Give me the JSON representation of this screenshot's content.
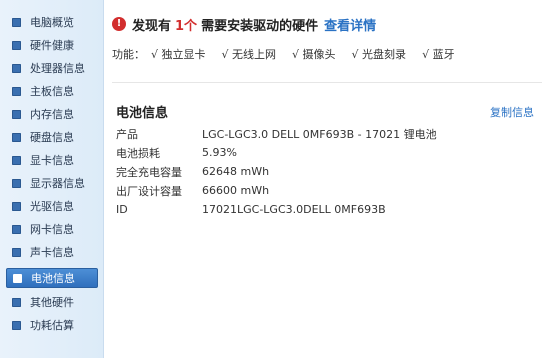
{
  "sidebar": {
    "items": [
      {
        "label": "电脑概览"
      },
      {
        "label": "硬件健康"
      },
      {
        "label": "处理器信息"
      },
      {
        "label": "主板信息"
      },
      {
        "label": "内存信息"
      },
      {
        "label": "硬盘信息"
      },
      {
        "label": "显卡信息"
      },
      {
        "label": "显示器信息"
      },
      {
        "label": "光驱信息"
      },
      {
        "label": "网卡信息"
      },
      {
        "label": "声卡信息"
      },
      {
        "label": "电池信息"
      },
      {
        "label": "其他硬件"
      },
      {
        "label": "功耗估算"
      }
    ],
    "active_index": 11
  },
  "alert": {
    "icon": "exclamation-icon",
    "prefix": "发现有",
    "count": "1个",
    "suffix": "需要安装驱动的硬件",
    "link": "查看详情"
  },
  "features": {
    "label": "功能：",
    "items": [
      "√ 独立显卡",
      "√ 无线上网",
      "√ 摄像头",
      "√ 光盘刻录",
      "√ 蓝牙"
    ]
  },
  "battery": {
    "title": "电池信息",
    "copy_label": "复制信息",
    "rows": [
      {
        "key": "产品",
        "value": "LGC-LGC3.0 DELL 0MF693B - 17021 锂电池"
      },
      {
        "key": "电池损耗",
        "value": "5.93%"
      },
      {
        "key": "完全充电容量",
        "value": "62648 mWh"
      },
      {
        "key": "出厂设计容量",
        "value": "66600 mWh"
      },
      {
        "key": "ID",
        "value": "17021LGC-LGC3.0DELL 0MF693B"
      }
    ]
  },
  "colors": {
    "accent": "#2a72c4",
    "alert": "#d22e2e",
    "sidebar_bg": "#dcebf8",
    "active_item": "#2f6fbd"
  }
}
